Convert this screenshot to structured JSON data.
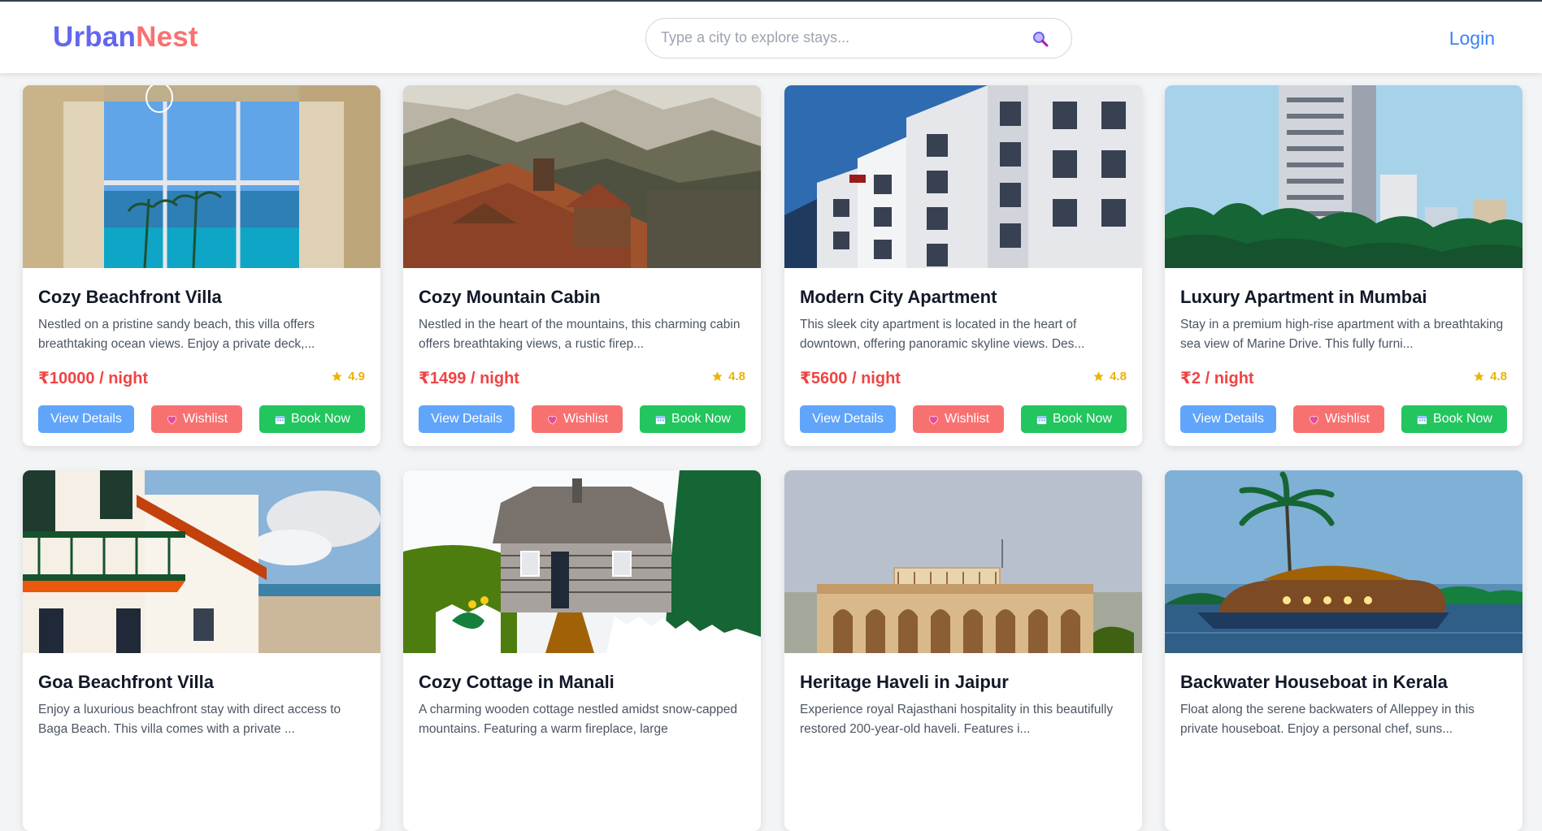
{
  "brand": {
    "part1": "Urban",
    "part2": "Nest"
  },
  "search": {
    "placeholder": "Type a city to explore stays..."
  },
  "nav": {
    "login_label": "Login"
  },
  "buttons": {
    "view": "View Details",
    "wishlist": "Wishlist",
    "book": "Book Now"
  },
  "icons": {
    "search": "search-icon",
    "star": "star-icon",
    "wishlist": "heart-icon",
    "book": "calendar-icon"
  },
  "colors": {
    "brand_primary": "#6366f1",
    "brand_accent": "#f87171",
    "price": "#ef4444",
    "rating": "#eab308",
    "view_button": "#60a5fa",
    "wishlist_button": "#f87171",
    "book_button": "#22c55e"
  },
  "listings": [
    {
      "title": "Cozy Beachfront Villa",
      "description": "Nestled on a pristine sandy beach, this villa offers breathtaking ocean views. Enjoy a private deck,...",
      "price": "₹10000 / night",
      "rating": "4.9",
      "image": "villa interior with ocean view"
    },
    {
      "title": "Cozy Mountain Cabin",
      "description": "Nestled in the heart of the mountains, this charming cabin offers breathtaking views, a rustic firep...",
      "price": "₹1499 / night",
      "rating": "4.8",
      "image": "mountain hotel rooftop"
    },
    {
      "title": "Modern City Apartment",
      "description": "This sleek city apartment is located in the heart of downtown, offering panoramic skyline views. Des...",
      "price": "₹5600 / night",
      "rating": "4.8",
      "image": "city apartment building"
    },
    {
      "title": "Luxury Apartment in Mumbai",
      "description": "Stay in a premium high-rise apartment with a breathtaking sea view of Marine Drive. This fully furni...",
      "price": "₹2 / night",
      "rating": "4.8",
      "image": "high-rise apartment tower"
    },
    {
      "title": "Goa Beachfront Villa",
      "description": "Enjoy a luxurious beachfront stay with direct access to Baga Beach. This villa comes with a private ...",
      "price": "",
      "rating": "",
      "image": "beachfront villa balcony"
    },
    {
      "title": "Cozy Cottage in Manali",
      "description": "A charming wooden cottage nestled amidst snow-capped mountains. Featuring a warm fireplace, large",
      "price": "",
      "rating": "",
      "image": "wooden cottage with garden"
    },
    {
      "title": "Heritage Haveli in Jaipur",
      "description": "Experience royal Rajasthani hospitality in this beautifully restored 200-year-old haveli. Features i...",
      "price": "",
      "rating": "",
      "image": "heritage haveli palace"
    },
    {
      "title": "Backwater Houseboat in Kerala",
      "description": "Float along the serene backwaters of Alleppey in this private houseboat. Enjoy a personal chef, suns...",
      "price": "",
      "rating": "",
      "image": "houseboat on backwaters"
    }
  ]
}
